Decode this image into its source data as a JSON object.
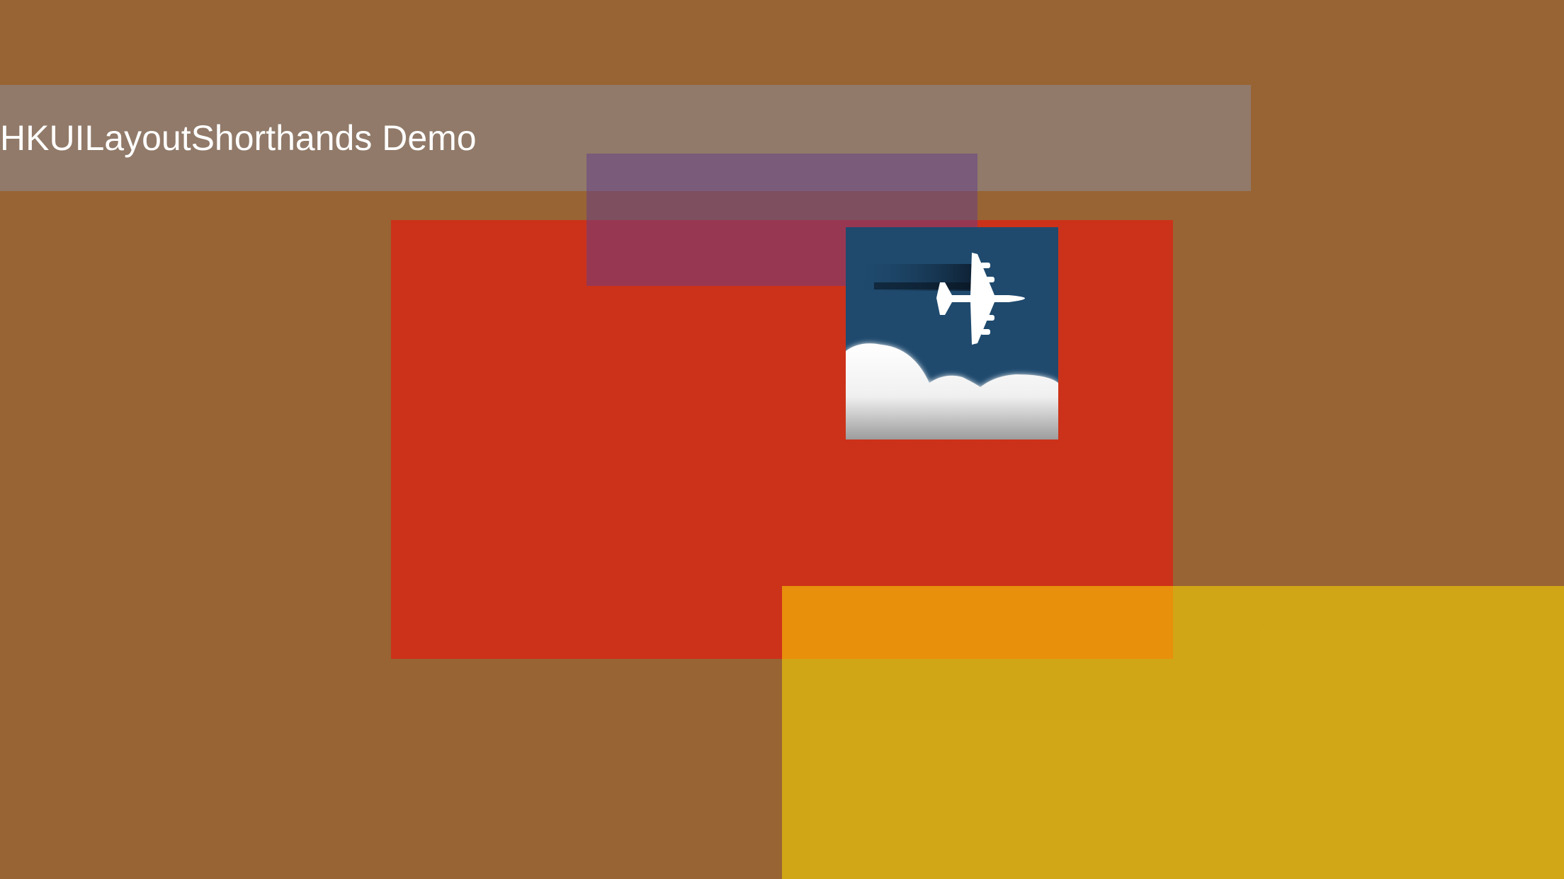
{
  "screen": {
    "background_color": "#986433",
    "title": "HKUILayoutShorthands Demo"
  },
  "colors": {
    "title_bar": "#8c8c96",
    "red_box": "#cc3219",
    "purple_box": "#643c8c",
    "yellow_box": "#ffdc00",
    "icon_sky": "#1f4a6e"
  },
  "icon": {
    "name": "airplane-icon"
  }
}
